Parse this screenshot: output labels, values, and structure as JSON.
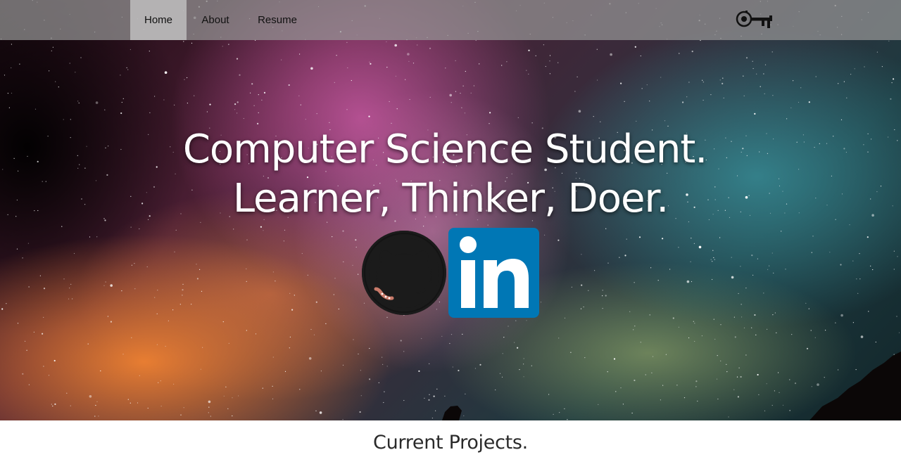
{
  "nav": {
    "items": [
      {
        "label": "Home",
        "active": true
      },
      {
        "label": "About",
        "active": false
      },
      {
        "label": "Resume",
        "active": false
      }
    ],
    "logo_icon": "key-icon"
  },
  "hero": {
    "line1": "Computer Science Student.",
    "line2": "Learner, Thinker, Doer.",
    "social": [
      {
        "icon": "github-icon"
      },
      {
        "icon": "linkedin-icon",
        "text": "in",
        "color": "#0077b5"
      }
    ]
  },
  "section": {
    "title": "Current Projects."
  }
}
